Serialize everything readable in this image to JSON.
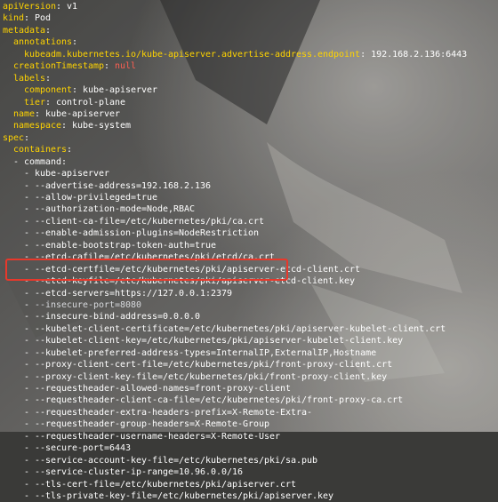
{
  "editor": {
    "lines": [
      {
        "indent": "",
        "key": "apiVersion",
        "sep": ": ",
        "value": "v1",
        "vclass": "v"
      },
      {
        "indent": "",
        "key": "kind",
        "sep": ": ",
        "value": "Pod",
        "vclass": "v"
      },
      {
        "indent": "",
        "key": "metadata",
        "sep": ":",
        "value": "",
        "vclass": "v"
      },
      {
        "indent": "  ",
        "key": "annotations",
        "sep": ":",
        "value": "",
        "vclass": "v"
      },
      {
        "indent": "    ",
        "key": "kubeadm.kubernetes.io/kube-apiserver.advertise-address.endpoint",
        "sep": ": ",
        "value": "192.168.2.136:6443",
        "vclass": "v"
      },
      {
        "indent": "  ",
        "key": "creationTimestamp",
        "sep": ": ",
        "value": "null",
        "vclass": "n"
      },
      {
        "indent": "  ",
        "key": "labels",
        "sep": ":",
        "value": "",
        "vclass": "v"
      },
      {
        "indent": "    ",
        "key": "component",
        "sep": ": ",
        "value": "kube-apiserver",
        "vclass": "v"
      },
      {
        "indent": "    ",
        "key": "tier",
        "sep": ": ",
        "value": "control-plane",
        "vclass": "v"
      },
      {
        "indent": "  ",
        "key": "name",
        "sep": ": ",
        "value": "kube-apiserver",
        "vclass": "v"
      },
      {
        "indent": "  ",
        "key": "namespace",
        "sep": ": ",
        "value": "kube-system",
        "vclass": "v"
      },
      {
        "indent": "",
        "key": "spec",
        "sep": ":",
        "value": "",
        "vclass": "v"
      },
      {
        "indent": "  ",
        "key": "containers",
        "sep": ":",
        "value": "",
        "vclass": "v"
      },
      {
        "indent": "  ",
        "key": "- command",
        "sep": ":",
        "value": "",
        "vclass": "v"
      },
      {
        "indent": "    ",
        "key": "- ",
        "sep": "",
        "value": "kube-apiserver",
        "vclass": "v"
      },
      {
        "indent": "    ",
        "key": "- ",
        "sep": "",
        "value": "--advertise-address=192.168.2.136",
        "vclass": "v"
      },
      {
        "indent": "    ",
        "key": "- ",
        "sep": "",
        "value": "--allow-privileged=true",
        "vclass": "v"
      },
      {
        "indent": "    ",
        "key": "- ",
        "sep": "",
        "value": "--authorization-mode=Node,RBAC",
        "vclass": "v"
      },
      {
        "indent": "    ",
        "key": "- ",
        "sep": "",
        "value": "--client-ca-file=/etc/kubernetes/pki/ca.crt",
        "vclass": "v"
      },
      {
        "indent": "    ",
        "key": "- ",
        "sep": "",
        "value": "--enable-admission-plugins=NodeRestriction",
        "vclass": "v"
      },
      {
        "indent": "    ",
        "key": "- ",
        "sep": "",
        "value": "--enable-bootstrap-token-auth=true",
        "vclass": "v"
      },
      {
        "indent": "    ",
        "key": "- ",
        "sep": "",
        "value": "--etcd-cafile=/etc/kubernetes/pki/etcd/ca.crt",
        "vclass": "v"
      },
      {
        "indent": "    ",
        "key": "- ",
        "sep": "",
        "value": "--etcd-certfile=/etc/kubernetes/pki/apiserver-etcd-client.crt",
        "vclass": "v"
      },
      {
        "indent": "    ",
        "key": "- ",
        "sep": "",
        "value": "--etcd-keyfile=/etc/kubernetes/pki/apiserver-etcd-client.key",
        "vclass": "v"
      },
      {
        "indent": "    ",
        "key": "- ",
        "sep": "",
        "value": "--etcd-servers=https://127.0.0.1:2379",
        "vclass": "v"
      },
      {
        "indent": "    ",
        "key": "- ",
        "sep": "",
        "value": "--insecure-port=8080",
        "vclass": "d"
      },
      {
        "indent": "    ",
        "key": "- ",
        "sep": "",
        "value": "--insecure-bind-address=0.0.0.0",
        "vclass": "v"
      },
      {
        "indent": "    ",
        "key": "- ",
        "sep": "",
        "value": "--kubelet-client-certificate=/etc/kubernetes/pki/apiserver-kubelet-client.crt",
        "vclass": "v"
      },
      {
        "indent": "    ",
        "key": "- ",
        "sep": "",
        "value": "--kubelet-client-key=/etc/kubernetes/pki/apiserver-kubelet-client.key",
        "vclass": "v"
      },
      {
        "indent": "    ",
        "key": "- ",
        "sep": "",
        "value": "--kubelet-preferred-address-types=InternalIP,ExternalIP,Hostname",
        "vclass": "v"
      },
      {
        "indent": "    ",
        "key": "- ",
        "sep": "",
        "value": "--proxy-client-cert-file=/etc/kubernetes/pki/front-proxy-client.crt",
        "vclass": "v"
      },
      {
        "indent": "    ",
        "key": "- ",
        "sep": "",
        "value": "--proxy-client-key-file=/etc/kubernetes/pki/front-proxy-client.key",
        "vclass": "v"
      },
      {
        "indent": "    ",
        "key": "- ",
        "sep": "",
        "value": "--requestheader-allowed-names=front-proxy-client",
        "vclass": "v"
      },
      {
        "indent": "    ",
        "key": "- ",
        "sep": "",
        "value": "--requestheader-client-ca-file=/etc/kubernetes/pki/front-proxy-ca.crt",
        "vclass": "v"
      },
      {
        "indent": "    ",
        "key": "- ",
        "sep": "",
        "value": "--requestheader-extra-headers-prefix=X-Remote-Extra-",
        "vclass": "v"
      },
      {
        "indent": "    ",
        "key": "- ",
        "sep": "",
        "value": "--requestheader-group-headers=X-Remote-Group",
        "vclass": "v"
      },
      {
        "indent": "    ",
        "key": "- ",
        "sep": "",
        "value": "--requestheader-username-headers=X-Remote-User",
        "vclass": "v"
      },
      {
        "indent": "    ",
        "key": "- ",
        "sep": "",
        "value": "--secure-port=6443",
        "vclass": "v"
      },
      {
        "indent": "    ",
        "key": "- ",
        "sep": "",
        "value": "--service-account-key-file=/etc/kubernetes/pki/sa.pub",
        "vclass": "v"
      },
      {
        "indent": "    ",
        "key": "- ",
        "sep": "",
        "value": "--service-cluster-ip-range=10.96.0.0/16",
        "vclass": "v"
      },
      {
        "indent": "    ",
        "key": "- ",
        "sep": "",
        "value": "--tls-cert-file=/etc/kubernetes/pki/apiserver.crt",
        "vclass": "v"
      },
      {
        "indent": "    ",
        "key": "- ",
        "sep": "",
        "value": "--tls-private-key-file=/etc/kubernetes/pki/apiserver.key",
        "vclass": "v"
      }
    ]
  },
  "colors": {
    "key": "#ffd400",
    "text": "#ffffff",
    "null": "#ff5f52",
    "highlight_box": "#e8382b"
  },
  "icons": [
    "background-wallpaper"
  ]
}
